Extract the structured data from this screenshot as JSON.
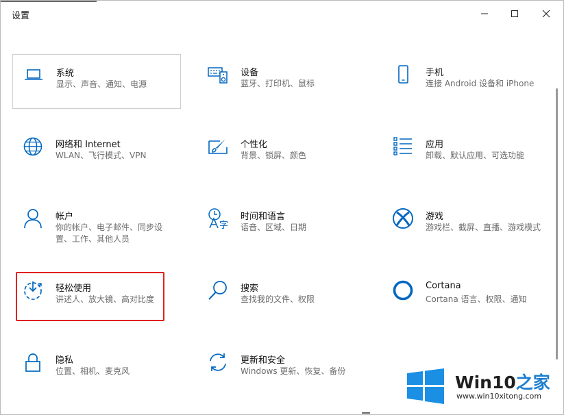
{
  "window": {
    "title": "设置",
    "controls": {
      "minimize": "minimize-icon",
      "maximize": "maximize-icon",
      "close": "close-icon"
    }
  },
  "accent_color": "#0067c0",
  "highlight_color": "#e0211f",
  "tiles": [
    {
      "name": "系统",
      "desc": "显示、声音、通知、电源",
      "icon": "laptop-icon"
    },
    {
      "name": "设备",
      "desc": "蓝牙、打印机、鼠标",
      "icon": "keyboard-speaker-icon"
    },
    {
      "name": "手机",
      "desc": "连接 Android 设备和 iPhone",
      "icon": "phone-icon"
    },
    {
      "name": "网络和 Internet",
      "desc": "WLAN、飞行模式、VPN",
      "icon": "globe-icon"
    },
    {
      "name": "个性化",
      "desc": "背景、锁屏、颜色",
      "icon": "paint-brush-icon"
    },
    {
      "name": "应用",
      "desc": "卸载、默认应用、可选功能",
      "icon": "app-list-icon"
    },
    {
      "name": "帐户",
      "desc": "你的帐户、电子邮件、同步设置、工作、其他人员",
      "icon": "person-icon"
    },
    {
      "name": "时间和语言",
      "desc": "语音、区域、日期",
      "icon": "time-language-icon"
    },
    {
      "name": "游戏",
      "desc": "游戏栏、截屏、直播、游戏模式",
      "icon": "xbox-icon"
    },
    {
      "name": "轻松使用",
      "desc": "讲述人、放大镜、高对比度",
      "icon": "ease-of-access-icon"
    },
    {
      "name": "搜索",
      "desc": "查找我的文件、权限",
      "icon": "search-icon"
    },
    {
      "name": "Cortana",
      "desc": "Cortana 语言、权限、通知",
      "icon": "cortana-icon"
    },
    {
      "name": "隐私",
      "desc": "位置、相机、麦克风",
      "icon": "lock-icon"
    },
    {
      "name": "更新和安全",
      "desc": "Windows 更新、恢复、备份",
      "icon": "sync-icon"
    }
  ],
  "watermark": {
    "title_prefix": "Win10",
    "title_suffix": "之家",
    "url": "www.win10xitong.com",
    "logo": "windows-logo-icon"
  }
}
